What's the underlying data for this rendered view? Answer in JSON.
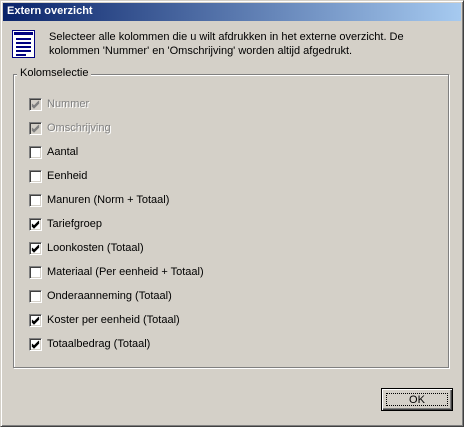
{
  "window": {
    "title": "Extern overzicht",
    "description": "Selecteer alle kolommen die u wilt afdrukken in het externe overzicht. De kolommen 'Nummer' en 'Omschrijving' worden altijd afgedrukt.",
    "icon": "document-list-icon"
  },
  "group": {
    "legend": "Kolomselectie",
    "columns": [
      {
        "label": "Nummer",
        "checked": true,
        "disabled": true
      },
      {
        "label": "Omschrijving",
        "checked": true,
        "disabled": true
      },
      {
        "label": "Aantal",
        "checked": false,
        "disabled": false
      },
      {
        "label": "Eenheid",
        "checked": false,
        "disabled": false
      },
      {
        "label": "Manuren (Norm + Totaal)",
        "checked": false,
        "disabled": false
      },
      {
        "label": "Tariefgroep",
        "checked": true,
        "disabled": false
      },
      {
        "label": "Loonkosten (Totaal)",
        "checked": true,
        "disabled": false
      },
      {
        "label": "Materiaal (Per eenheid + Totaal)",
        "checked": false,
        "disabled": false
      },
      {
        "label": "Onderaanneming (Totaal)",
        "checked": false,
        "disabled": false
      },
      {
        "label": "Koster per eenheid (Totaal)",
        "checked": true,
        "disabled": false
      },
      {
        "label": "Totaalbedrag (Totaal)",
        "checked": true,
        "disabled": false
      }
    ]
  },
  "buttons": {
    "ok_label": "OK"
  },
  "colors": {
    "titlebar_start": "#0a246a",
    "titlebar_end": "#a6caf0",
    "face": "#d4d0c8"
  }
}
